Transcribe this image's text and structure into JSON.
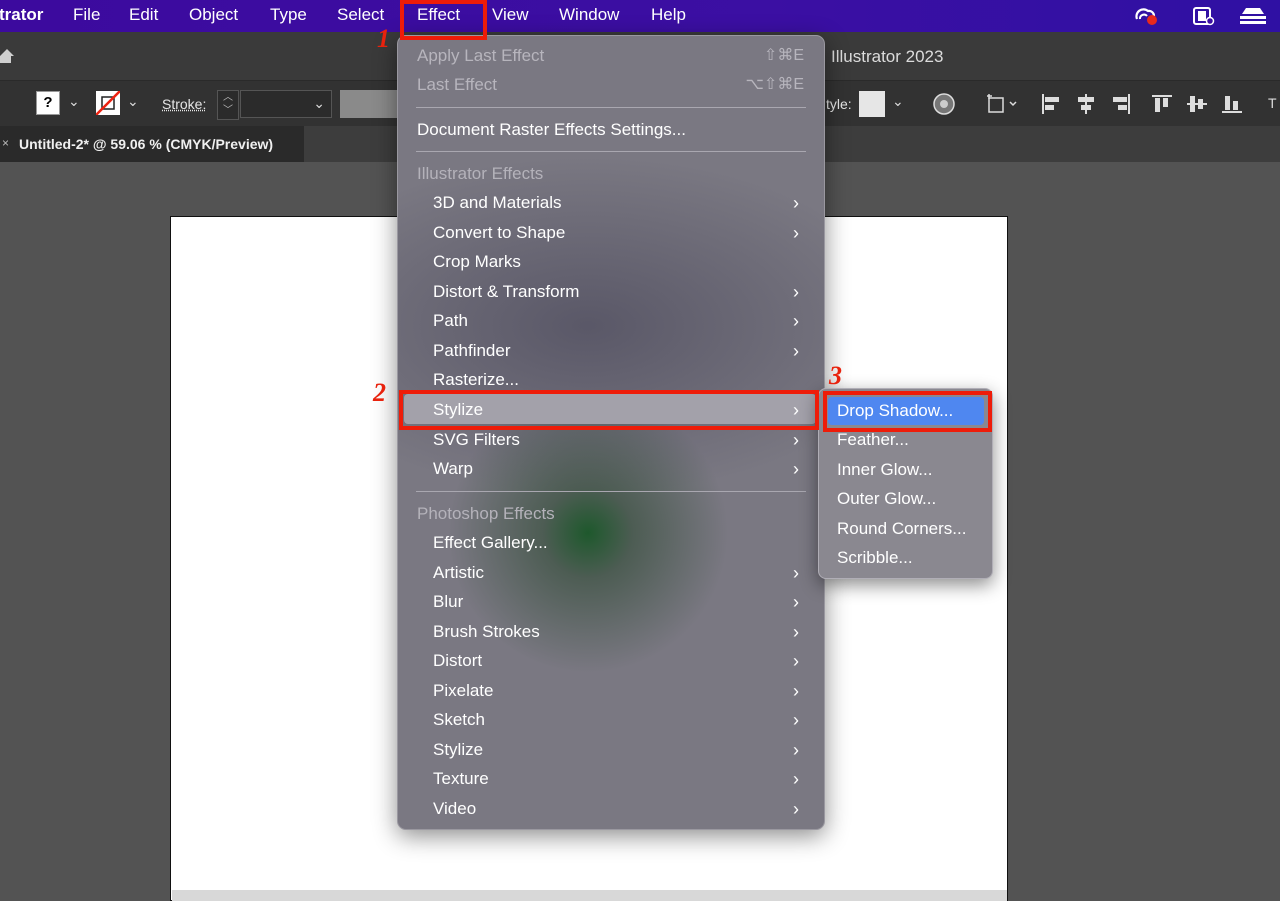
{
  "menubar": {
    "app": "trator",
    "items": [
      "File",
      "Edit",
      "Object",
      "Type",
      "Select",
      "Effect",
      "View",
      "Window",
      "Help"
    ]
  },
  "titlebar": {
    "title": "Illustrator 2023"
  },
  "control_bar": {
    "stroke_label": "Stroke:",
    "style_label": "tyle:"
  },
  "tab": {
    "title": "Untitled-2* @ 59.06 % (CMYK/Preview)",
    "close": "×"
  },
  "effect_menu": {
    "apply_last": {
      "label": "Apply Last Effect",
      "shortcut": "⇧⌘E"
    },
    "last": {
      "label": "Last Effect",
      "shortcut": "⌥⇧⌘E"
    },
    "doc_raster": "Document Raster Effects Settings...",
    "illustrator_header": "Illustrator Effects",
    "illustrator_items": [
      "3D and Materials",
      "Convert to Shape",
      "Crop Marks",
      "Distort & Transform",
      "Path",
      "Pathfinder",
      "Rasterize...",
      "Stylize",
      "SVG Filters",
      "Warp"
    ],
    "photoshop_header": "Photoshop Effects",
    "photoshop_items": [
      "Effect Gallery...",
      "Artistic",
      "Blur",
      "Brush Strokes",
      "Distort",
      "Pixelate",
      "Sketch",
      "Stylize",
      "Texture",
      "Video"
    ],
    "highlighted": "Stylize"
  },
  "stylize_submenu": {
    "items": [
      "Drop Shadow...",
      "Feather...",
      "Inner Glow...",
      "Outer Glow...",
      "Round Corners...",
      "Scribble..."
    ],
    "highlighted": "Drop Shadow..."
  },
  "annotations": [
    "1",
    "2",
    "3"
  ],
  "colors": {
    "menubar": "#3b0fa3",
    "highlight_blue": "#4f87f0",
    "annotation_red": "#ee1c09"
  }
}
